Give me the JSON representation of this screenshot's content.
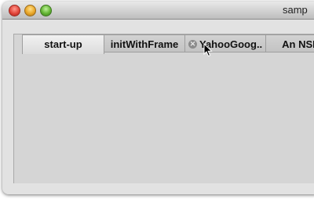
{
  "window": {
    "title": "samp"
  },
  "tabs": [
    {
      "label": "start-up",
      "selected": true
    },
    {
      "label": "initWithFrame",
      "selected": false
    },
    {
      "label": "YahooGoog..",
      "selected": false,
      "close_icon": "close-circle-icon"
    },
    {
      "label": "An NSIr",
      "selected": false
    }
  ],
  "colors": {
    "close": "#e2463b",
    "minimize": "#e9a628",
    "zoom": "#62b432"
  }
}
